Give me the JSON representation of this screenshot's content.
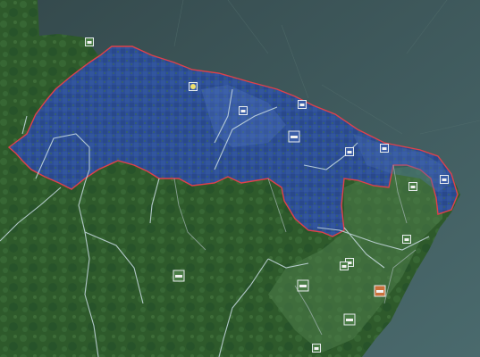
{
  "map": {
    "ocean_color": "#3f5a5c",
    "land_color": "#2f5a2c",
    "land_light_color": "#4d7a49",
    "selected_region_color": "#2f4f9a",
    "selected_region_highlight": "#5075c0",
    "selected_border_color": "#e0414a",
    "river_color": "#c6d9e2",
    "province_line_color": "#9fb0b2"
  },
  "icons": [
    {
      "name": "city-icon",
      "kind": "city",
      "owner": "neutral"
    },
    {
      "name": "fort-icon",
      "kind": "fort",
      "owner": "player"
    },
    {
      "name": "building-icon",
      "kind": "building",
      "owner": "player"
    },
    {
      "name": "port-icon",
      "kind": "port",
      "owner": "player"
    },
    {
      "name": "capital-icon",
      "kind": "capital",
      "owner": "player"
    },
    {
      "name": "town-icon",
      "kind": "town",
      "owner": "player"
    },
    {
      "name": "town-icon",
      "kind": "town",
      "owner": "player"
    },
    {
      "name": "coastal-town-icon",
      "kind": "town",
      "owner": "player"
    },
    {
      "name": "town-icon",
      "kind": "town",
      "owner": "neutral"
    },
    {
      "name": "village-icon",
      "kind": "village",
      "owner": "neutral"
    },
    {
      "name": "town-icon",
      "kind": "town",
      "owner": "neutral"
    },
    {
      "name": "village-icon",
      "kind": "village",
      "owner": "neutral"
    },
    {
      "name": "factory-icon",
      "kind": "factory",
      "owner": "neutral"
    },
    {
      "name": "factory-icon",
      "kind": "factory",
      "owner": "neutral"
    },
    {
      "name": "market-icon",
      "kind": "market",
      "owner": "neutral"
    },
    {
      "name": "factory-icon",
      "kind": "factory",
      "owner": "neutral"
    },
    {
      "name": "village-icon",
      "kind": "village",
      "owner": "neutral"
    }
  ]
}
